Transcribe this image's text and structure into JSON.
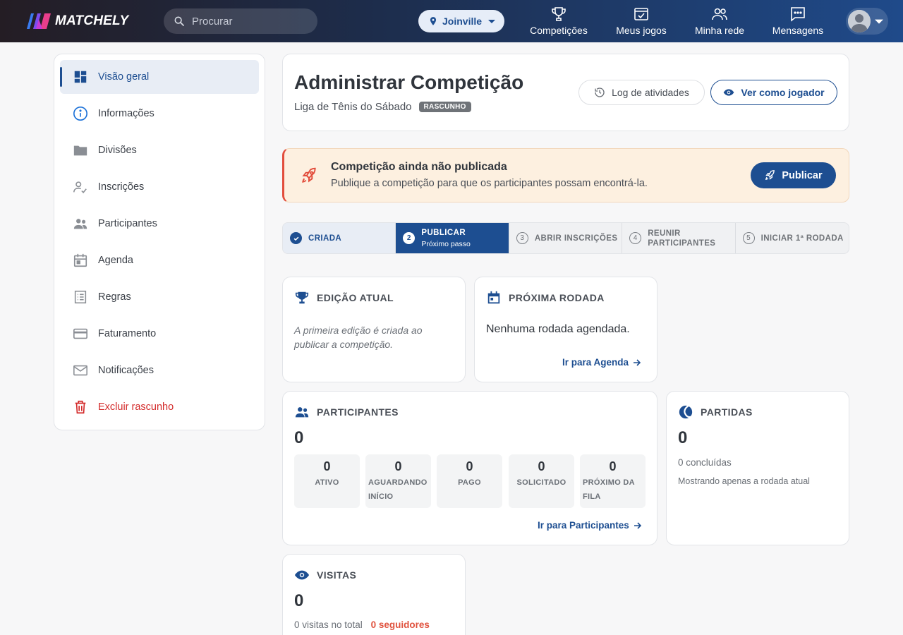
{
  "app": {
    "name": "MATCHELY"
  },
  "search": {
    "placeholder": "Procurar"
  },
  "city": {
    "label": "Joinville"
  },
  "nav": {
    "competitions": "Competições",
    "my_games": "Meus jogos",
    "network": "Minha rede",
    "messages": "Mensagens"
  },
  "sidebar": {
    "items": [
      {
        "label": "Visão geral"
      },
      {
        "label": "Informações"
      },
      {
        "label": "Divisões"
      },
      {
        "label": "Inscrições"
      },
      {
        "label": "Participantes"
      },
      {
        "label": "Agenda"
      },
      {
        "label": "Regras"
      },
      {
        "label": "Faturamento"
      },
      {
        "label": "Notificações"
      },
      {
        "label": "Excluir rascunho"
      }
    ]
  },
  "header": {
    "title": "Administrar Competição",
    "subtitle": "Liga de Tênis do Sábado",
    "badge": "RASCUNHO",
    "log_button": "Log de atividades",
    "view_button": "Ver como jogador"
  },
  "alert": {
    "title": "Competição ainda não publicada",
    "description": "Publique a competição para que os participantes possam encontrá-la.",
    "publish_button": "Publicar"
  },
  "stepper": {
    "steps": [
      {
        "num": "",
        "label": "CRIADA",
        "sub": "",
        "state": "done"
      },
      {
        "num": "2",
        "label": "PUBLICAR",
        "sub": "Próximo passo",
        "state": "current"
      },
      {
        "num": "3",
        "label": "ABRIR INSCRIÇÕES",
        "sub": "",
        "state": "pending"
      },
      {
        "num": "4",
        "label": "REUNIR PARTICIPANTES",
        "sub": "",
        "state": "pending"
      },
      {
        "num": "5",
        "label": "INICIAR 1ª RODADA",
        "sub": "",
        "state": "pending"
      }
    ]
  },
  "edition": {
    "title": "EDIÇÃO ATUAL",
    "note": "A primeira edição é criada ao publicar a competição."
  },
  "next_round": {
    "title": "PRÓXIMA RODADA",
    "text": "Nenhuma rodada agendada.",
    "link": "Ir para Agenda"
  },
  "participants": {
    "title": "PARTICIPANTES",
    "total": "0",
    "stats": [
      {
        "value": "0",
        "label": "ATIVO"
      },
      {
        "value": "0",
        "label": "AGUARDANDO INÍCIO"
      },
      {
        "value": "0",
        "label": "PAGO"
      },
      {
        "value": "0",
        "label": "SOLICITADO"
      },
      {
        "value": "0",
        "label": "PRÓXIMO DA FILA"
      }
    ],
    "link": "Ir para Participantes"
  },
  "matches": {
    "title": "PARTIDAS",
    "total": "0",
    "completed": "0 concluídas",
    "note": "Mostrando apenas a rodada atual"
  },
  "visits": {
    "title": "VISITAS",
    "total": "0",
    "total_visits": "0 visitas no total",
    "followers": "0 seguidores"
  },
  "colors": {
    "primary": "#1d4e91",
    "danger": "#d32a2a",
    "alert_bg": "#fdf0e0",
    "accent_orange": "#e0533f"
  }
}
